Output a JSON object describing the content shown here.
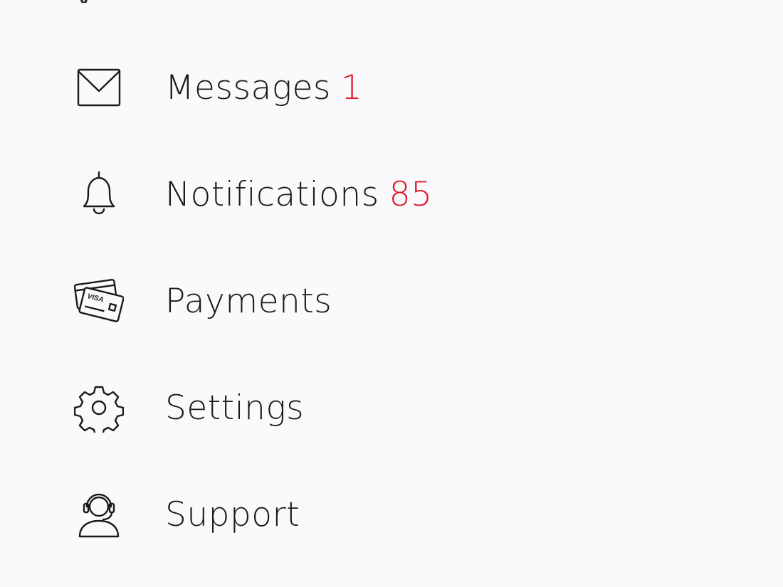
{
  "menu": {
    "items": [
      {
        "key": "messages",
        "label": "Messages",
        "badge": "1",
        "icon": "envelope-icon"
      },
      {
        "key": "notifications",
        "label": "Notifications",
        "badge": "85",
        "icon": "bell-icon"
      },
      {
        "key": "payments",
        "label": "Payments",
        "badge": "",
        "icon": "credit-card-icon"
      },
      {
        "key": "settings",
        "label": "Settings",
        "badge": "",
        "icon": "gear-icon"
      },
      {
        "key": "support",
        "label": "Support",
        "badge": "",
        "icon": "headset-icon"
      }
    ],
    "card_text": "VISA"
  },
  "colors": {
    "background": "#faf9fb",
    "text": "#1a1a1a",
    "badge": "#e0142a"
  }
}
